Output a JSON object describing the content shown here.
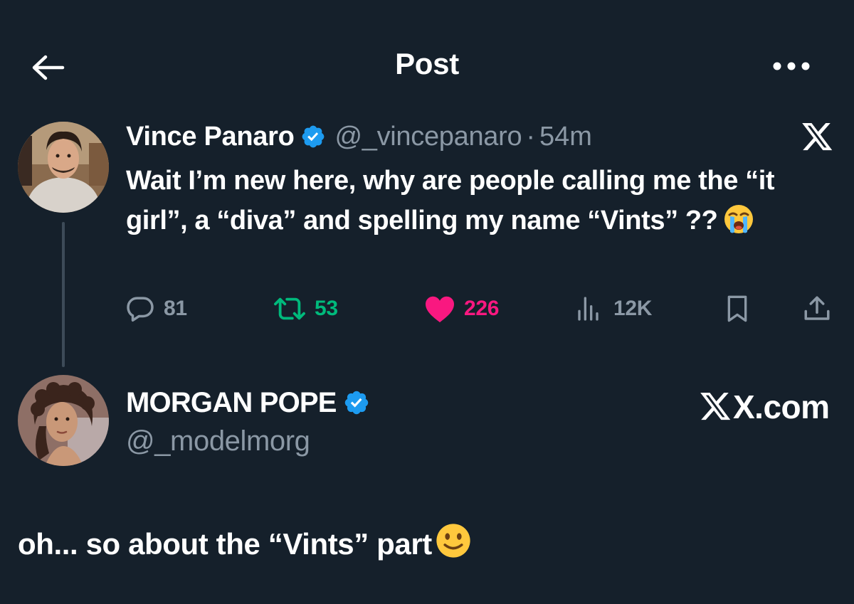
{
  "header": {
    "title": "Post",
    "back_icon": "arrow-left-icon",
    "more_icon": "more-horizontal-icon"
  },
  "tweet": {
    "author_name": "Vince Panaro",
    "handle": "@_vincepanaro",
    "separator": "·",
    "time": "54m",
    "verified": true,
    "text": "Wait I’m new here, why are people calling me the “it girl”, a “diva” and spelling my name “Vints” ??",
    "text_emoji": "loudly-crying-face",
    "stats": {
      "replies": "81",
      "retweets": "53",
      "likes": "226",
      "views": "12K"
    }
  },
  "reply_author": {
    "name": "MORGAN POPE",
    "handle": "@_modelmorg",
    "verified": true
  },
  "watermark": "X.com",
  "caption": {
    "text": "oh... so about the “Vints” part",
    "emoji": "slightly-smiling-face"
  },
  "colors": {
    "background": "#15202b",
    "secondary_text": "#8b98a5",
    "verified": "#1d9bf0",
    "retweet": "#00ba7c",
    "like": "#f91880",
    "thread_line": "#3d4b58"
  }
}
